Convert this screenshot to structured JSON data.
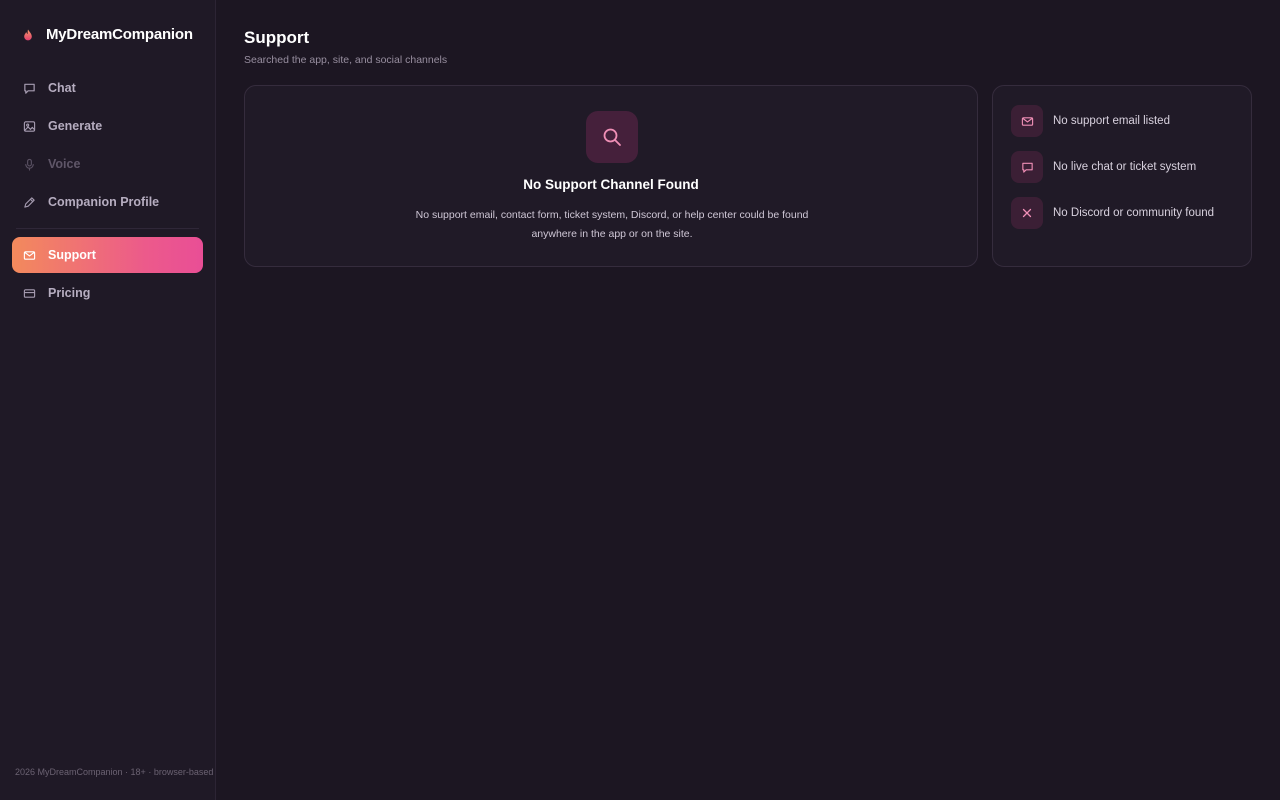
{
  "brand": {
    "name": "MyDreamCompanion",
    "accent": "#e94e96"
  },
  "sidebar": {
    "items": [
      {
        "label": "Chat",
        "icon": "chat-bubble-icon"
      },
      {
        "label": "Generate",
        "icon": "image-icon"
      },
      {
        "label": "Voice",
        "icon": "microphone-icon",
        "state": "disabled"
      },
      {
        "label": "Companion Profile",
        "icon": "pencil-icon"
      },
      {
        "label": "Support",
        "icon": "mail-icon",
        "state": "active"
      },
      {
        "label": "Pricing",
        "icon": "credit-card-icon"
      }
    ],
    "footer": "2026 MyDreamCompanion · 18+ · browser-based"
  },
  "page": {
    "title": "Support",
    "subtitle": "Searched the app, site, and social channels"
  },
  "result": {
    "icon": "search-icon",
    "title": "No Support Channel Found",
    "description": "No support email, contact form, ticket system, Discord, or help center could be found anywhere in the app or on the site."
  },
  "checks": [
    {
      "icon": "mail-icon",
      "label": "No support email listed"
    },
    {
      "icon": "chat-bubble-icon",
      "label": "No live chat or ticket system"
    },
    {
      "icon": "close-icon",
      "label": "No Discord or community found"
    }
  ],
  "colors": {
    "background": "#1c1622",
    "sidebar": "#1f1926",
    "card": "#201a27",
    "active_gradient_start": "#f38a5c",
    "active_gradient_end": "#e94e96",
    "icon_badge": "#45203b"
  }
}
